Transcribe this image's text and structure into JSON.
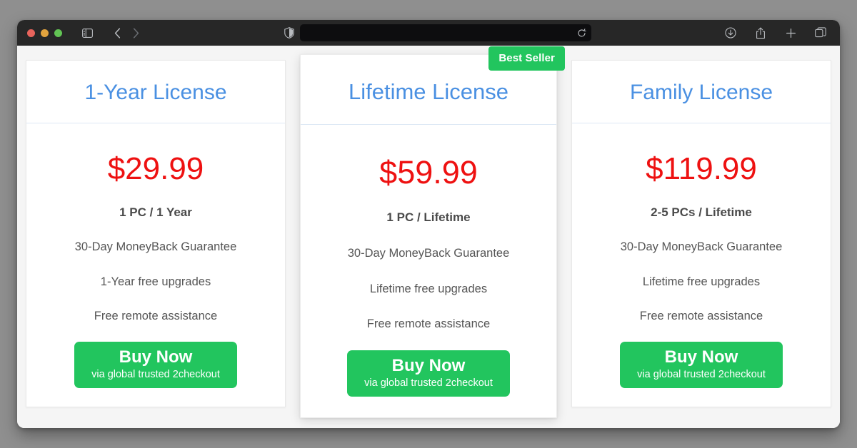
{
  "browser": {
    "traffic_lights": [
      {
        "name": "close",
        "color": "#e8645c"
      },
      {
        "name": "minimize",
        "color": "#e2a33e"
      },
      {
        "name": "zoom",
        "color": "#62c454"
      }
    ],
    "sidebar_toggle_icon": "sidebar-icon",
    "back_icon": "chevron-left-icon",
    "forward_icon": "chevron-right-icon",
    "privacy_icon": "shield-icon",
    "address_value": "",
    "address_placeholder": "",
    "reload_icon": "reload-icon",
    "downloads_icon": "download-icon",
    "share_icon": "share-icon",
    "new_tab_icon": "plus-icon",
    "tab_overview_icon": "tabs-icon"
  },
  "theme": {
    "accent_blue": "#4a90e2",
    "price_red": "#ee1111",
    "brand_green": "#22c55e",
    "page_background": "#f5f5f5",
    "card_background": "#ffffff",
    "divider": "#dde8f5"
  },
  "badge": {
    "label": "Best Seller"
  },
  "plans": [
    {
      "id": "one-year",
      "title": "1-Year License",
      "price": "$29.99",
      "seats": "1 PC / 1 Year",
      "features": [
        "30-Day MoneyBack Guarantee",
        "1-Year free upgrades",
        "Free remote assistance"
      ],
      "cta_main": "Buy Now",
      "cta_sub": "via global trusted 2checkout",
      "featured": false
    },
    {
      "id": "lifetime",
      "title": "Lifetime License",
      "price": "$59.99",
      "seats": "1 PC / Lifetime",
      "features": [
        "30-Day MoneyBack Guarantee",
        "Lifetime free upgrades",
        "Free remote assistance"
      ],
      "cta_main": "Buy Now",
      "cta_sub": "via global trusted 2checkout",
      "featured": true
    },
    {
      "id": "family",
      "title": "Family License",
      "price": "$119.99",
      "seats": "2-5 PCs / Lifetime",
      "features": [
        "30-Day MoneyBack Guarantee",
        "Lifetime free upgrades",
        "Free remote assistance"
      ],
      "cta_main": "Buy Now",
      "cta_sub": "via global trusted 2checkout",
      "featured": false
    }
  ]
}
